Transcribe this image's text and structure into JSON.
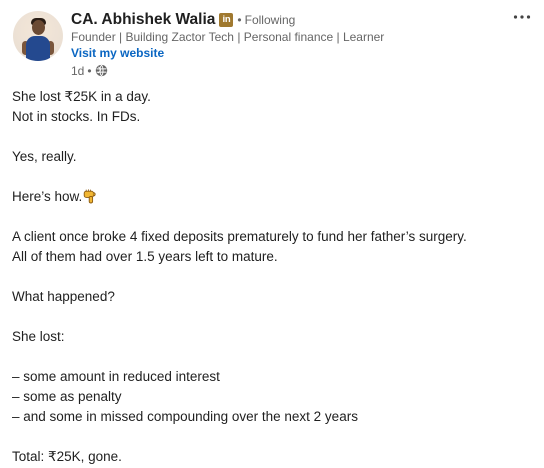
{
  "author": {
    "name": "CA. Abhishek Walia",
    "badge": "in",
    "following": "Following",
    "headline": "Founder | Building Zactor Tech | Personal finance | Learner",
    "website_link": "Visit my website",
    "time": "1d",
    "visibility_icon": "globe-icon"
  },
  "menu": {
    "icon": "more-options-icon"
  },
  "post": {
    "lines": [
      "She lost ₹25K in a day.",
      "Not in stocks. In FDs.",
      "",
      "Yes, really.",
      "",
      "Here’s how.",
      "",
      "A client once broke 4 fixed deposits prematurely to fund her father’s surgery.",
      "All of them had over 1.5 years left to mature.",
      "",
      "What happened?",
      "",
      "She lost:",
      "",
      "– some amount in reduced interest",
      "– some as penalty",
      "– and some in missed compounding over the next 2 years",
      "",
      "Total: ₹25K, gone."
    ],
    "emoji": "pointing-down-hand-icon"
  },
  "colors": {
    "link": "#0a66c2",
    "secondary_text": "#666666",
    "primary_text": "#1f1f1f",
    "badge": "#a0792f"
  }
}
